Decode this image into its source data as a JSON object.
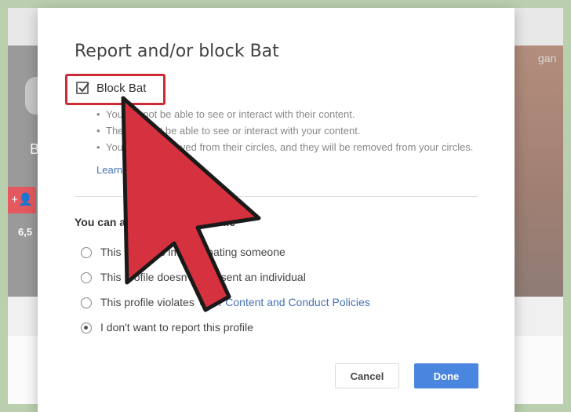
{
  "background": {
    "left_name_fragment": "B",
    "left_count_fragment": "6,5",
    "left_add_icon": "add-person-icon",
    "right_name_fragment": "gan"
  },
  "dialog": {
    "title": "Report and/or block Bat",
    "block_checkbox": {
      "label": "Block Bat",
      "checked": true
    },
    "bullets": [
      "You will not be able to see or interact with their content.",
      "They will not be able to see or interact with your content.",
      "You will be removed from their circles, and they will be removed from your circles."
    ],
    "learn_more": "Learn more",
    "report_heading": "You can also report this profile",
    "report_options": [
      {
        "label": "This profile is impersonating someone",
        "link": "",
        "checked": false
      },
      {
        "label": "This profile doesn't represent an individual",
        "link": "",
        "checked": false
      },
      {
        "label": "This profile violates",
        "link": "User Content and Conduct Policies",
        "checked": false
      },
      {
        "label": "I don't want to report this profile",
        "link": "",
        "checked": true
      }
    ],
    "cancel_label": "Cancel",
    "done_label": "Done"
  },
  "colors": {
    "highlight_red": "#cc2b36",
    "arrow_red": "#d6313f",
    "primary_blue": "#4a86e0",
    "link_blue": "#4672b5"
  }
}
